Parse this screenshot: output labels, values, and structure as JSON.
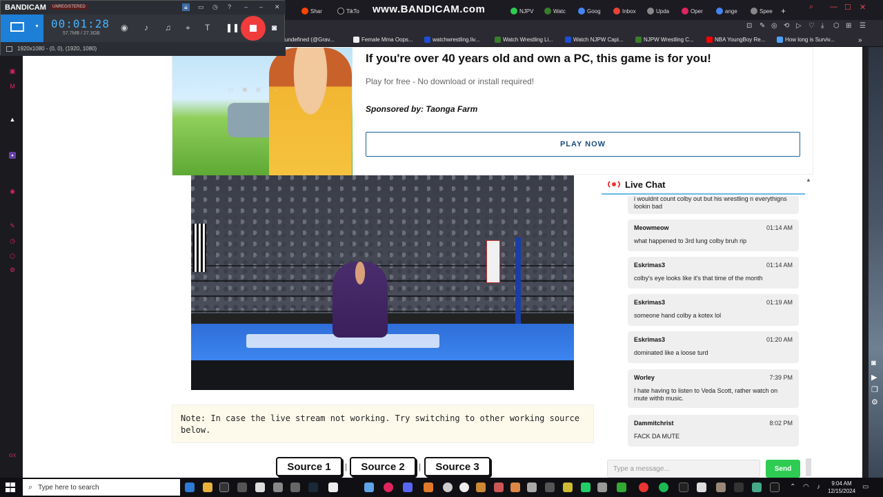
{
  "browser": {
    "watermark": "www.BANDICAM.com",
    "tabs": [
      {
        "label": "Shar",
        "color": "#ff4500"
      },
      {
        "label": "TikTo",
        "color": "#111111"
      },
      {
        "label": "NJPV",
        "color": "#2ecc52"
      },
      {
        "label": "Watc",
        "color": "#3a7d2a"
      },
      {
        "label": "Goog",
        "color": "#4285f4"
      },
      {
        "label": "Inbox",
        "color": "#ea4335"
      },
      {
        "label": "Upda",
        "color": "#888888"
      },
      {
        "label": "Oper",
        "color": "#e0245e"
      },
      {
        "label": "ange",
        "color": "#4285f4"
      },
      {
        "label": "Spee",
        "color": "#888888"
      }
    ],
    "bookmarks": [
      {
        "label": "undefined (@Grav...",
        "color": "#1d9bf0"
      },
      {
        "label": "Female Mma Oops...",
        "color": "#eeeeee"
      },
      {
        "label": "watchwrestling.liv...",
        "color": "#1d4ed8"
      },
      {
        "label": "Watch Wrestling Li...",
        "color": "#3a7d2a"
      },
      {
        "label": "Watch NJPW Capi...",
        "color": "#1d4ed8"
      },
      {
        "label": "NJPW Wrestling C...",
        "color": "#3a7d2a"
      },
      {
        "label": "NBA YoungBoy Re...",
        "color": "#ff0000"
      },
      {
        "label": "How long is Surviv...",
        "color": "#4da3ff"
      }
    ]
  },
  "bandicam": {
    "logo": "BANDICAM",
    "unregistered": "UNREGISTERED",
    "timer": "00:01:28",
    "filesize": "57.7MB / 27.3GB",
    "resolution": "1920x1080 - (0, 0), (1920, 1080)"
  },
  "ad": {
    "title": "If you're over 40 years old and own a PC, this game is for you!",
    "subtitle": "Play for free - No download or install required!",
    "sponsor": "Sponsored by: Taonga Farm",
    "cta": "PLAY NOW"
  },
  "note": "Note: In case the live stream not working. Try switching to other working source below.",
  "sources": [
    "Source 1",
    "Source 2",
    "Source 3"
  ],
  "chat": {
    "title": "Live Chat",
    "partial_message": "i wouldnt count colby out but his wrestling n everythigns lookin bad",
    "messages": [
      {
        "user": "Meowmeow",
        "time": "01:14 AM",
        "text": "what happened to 3rd lung colby bruh rip"
      },
      {
        "user": "Eskrimas3",
        "time": "01:14 AM",
        "text": "colby's eye looks like it's that time of the month"
      },
      {
        "user": "Eskrimas3",
        "time": "01:19 AM",
        "text": "someone hand colby a kotex lol"
      },
      {
        "user": "Eskrimas3",
        "time": "01:20 AM",
        "text": "dominated like a loose turd"
      },
      {
        "user": "Worley",
        "time": "7:39 PM",
        "text": "I hate having to listen to Veda Scott, rather watch on mute withb music."
      },
      {
        "user": "Dammitchrist",
        "time": "8:02 PM",
        "text": "FACK DA MUTE"
      }
    ],
    "input_placeholder": "Type a message...",
    "send_label": "Send"
  },
  "taskbar": {
    "search_placeholder": "Type here to search",
    "time": "9:04 AM",
    "date": "12/15/2024"
  }
}
